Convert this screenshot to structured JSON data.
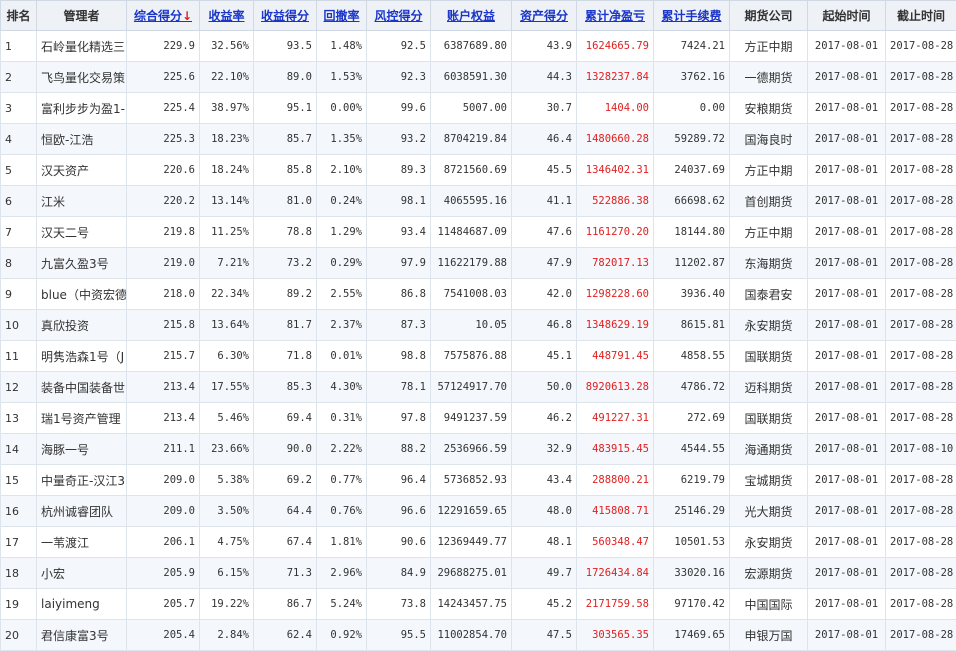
{
  "headers": {
    "rank": "排名",
    "manager": "管理者",
    "composite": "综合得分",
    "composite_arrow": "↓",
    "return_rate": "收益率",
    "return_score": "收益得分",
    "drawdown": "回撤率",
    "risk_score": "风控得分",
    "equity": "账户权益",
    "asset_score": "资产得分",
    "net_pnl": "累计净盈亏",
    "fees": "累计手续费",
    "broker": "期货公司",
    "start": "起始时间",
    "end": "截止时间"
  },
  "colors": {
    "sort_link": "#1a35c8",
    "pnl_red": "#e02020",
    "header_bg": "#eef2f7"
  },
  "rows": [
    {
      "rank": "1",
      "manager": "石岭量化精选三",
      "composite": "229.9",
      "return_rate": "32.56%",
      "return_score": "93.5",
      "drawdown": "1.48%",
      "risk_score": "92.5",
      "equity": "6387689.80",
      "asset_score": "43.9",
      "net_pnl": "1624665.79",
      "fees": "7424.21",
      "broker": "方正中期",
      "start": "2017-08-01",
      "end": "2017-08-28"
    },
    {
      "rank": "2",
      "manager": "飞鸟量化交易策",
      "composite": "225.6",
      "return_rate": "22.10%",
      "return_score": "89.0",
      "drawdown": "1.53%",
      "risk_score": "92.3",
      "equity": "6038591.30",
      "asset_score": "44.3",
      "net_pnl": "1328237.84",
      "fees": "3762.16",
      "broker": "一德期货",
      "start": "2017-08-01",
      "end": "2017-08-28"
    },
    {
      "rank": "3",
      "manager": "富利步步为盈1-",
      "composite": "225.4",
      "return_rate": "38.97%",
      "return_score": "95.1",
      "drawdown": "0.00%",
      "risk_score": "99.6",
      "equity": "5007.00",
      "asset_score": "30.7",
      "net_pnl": "1404.00",
      "fees": "0.00",
      "broker": "安粮期货",
      "start": "2017-08-01",
      "end": "2017-08-28"
    },
    {
      "rank": "4",
      "manager": "恒欧-江浩",
      "composite": "225.3",
      "return_rate": "18.23%",
      "return_score": "85.7",
      "drawdown": "1.35%",
      "risk_score": "93.2",
      "equity": "8704219.84",
      "asset_score": "46.4",
      "net_pnl": "1480660.28",
      "fees": "59289.72",
      "broker": "国海良时",
      "start": "2017-08-01",
      "end": "2017-08-28"
    },
    {
      "rank": "5",
      "manager": "汉天资产",
      "composite": "220.6",
      "return_rate": "18.24%",
      "return_score": "85.8",
      "drawdown": "2.10%",
      "risk_score": "89.3",
      "equity": "8721560.69",
      "asset_score": "45.5",
      "net_pnl": "1346402.31",
      "fees": "24037.69",
      "broker": "方正中期",
      "start": "2017-08-01",
      "end": "2017-08-28"
    },
    {
      "rank": "6",
      "manager": "江米",
      "composite": "220.2",
      "return_rate": "13.14%",
      "return_score": "81.0",
      "drawdown": "0.24%",
      "risk_score": "98.1",
      "equity": "4065595.16",
      "asset_score": "41.1",
      "net_pnl": "522886.38",
      "fees": "66698.62",
      "broker": "首创期货",
      "start": "2017-08-01",
      "end": "2017-08-28"
    },
    {
      "rank": "7",
      "manager": "汉天二号",
      "composite": "219.8",
      "return_rate": "11.25%",
      "return_score": "78.8",
      "drawdown": "1.29%",
      "risk_score": "93.4",
      "equity": "11484687.09",
      "asset_score": "47.6",
      "net_pnl": "1161270.20",
      "fees": "18144.80",
      "broker": "方正中期",
      "start": "2017-08-01",
      "end": "2017-08-28"
    },
    {
      "rank": "8",
      "manager": "九富久盈3号",
      "composite": "219.0",
      "return_rate": "7.21%",
      "return_score": "73.2",
      "drawdown": "0.29%",
      "risk_score": "97.9",
      "equity": "11622179.88",
      "asset_score": "47.9",
      "net_pnl": "782017.13",
      "fees": "11202.87",
      "broker": "东海期货",
      "start": "2017-08-01",
      "end": "2017-08-28"
    },
    {
      "rank": "9",
      "manager": "blue（中资宏德",
      "composite": "218.0",
      "return_rate": "22.34%",
      "return_score": "89.2",
      "drawdown": "2.55%",
      "risk_score": "86.8",
      "equity": "7541008.03",
      "asset_score": "42.0",
      "net_pnl": "1298228.60",
      "fees": "3936.40",
      "broker": "国泰君安",
      "start": "2017-08-01",
      "end": "2017-08-28"
    },
    {
      "rank": "10",
      "manager": "真欣投资",
      "composite": "215.8",
      "return_rate": "13.64%",
      "return_score": "81.7",
      "drawdown": "2.37%",
      "risk_score": "87.3",
      "equity": "10.05",
      "asset_score": "46.8",
      "net_pnl": "1348629.19",
      "fees": "8615.81",
      "broker": "永安期货",
      "start": "2017-08-01",
      "end": "2017-08-28"
    },
    {
      "rank": "11",
      "manager": "明隽浩森1号（J",
      "composite": "215.7",
      "return_rate": "6.30%",
      "return_score": "71.8",
      "drawdown": "0.01%",
      "risk_score": "98.8",
      "equity": "7575876.88",
      "asset_score": "45.1",
      "net_pnl": "448791.45",
      "fees": "4858.55",
      "broker": "国联期货",
      "start": "2017-08-01",
      "end": "2017-08-28"
    },
    {
      "rank": "12",
      "manager": "装备中国装备世",
      "composite": "213.4",
      "return_rate": "17.55%",
      "return_score": "85.3",
      "drawdown": "4.30%",
      "risk_score": "78.1",
      "equity": "57124917.70",
      "asset_score": "50.0",
      "net_pnl": "8920613.28",
      "fees": "4786.72",
      "broker": "迈科期货",
      "start": "2017-08-01",
      "end": "2017-08-28"
    },
    {
      "rank": "13",
      "manager": "瑞1号资产管理",
      "composite": "213.4",
      "return_rate": "5.46%",
      "return_score": "69.4",
      "drawdown": "0.31%",
      "risk_score": "97.8",
      "equity": "9491237.59",
      "asset_score": "46.2",
      "net_pnl": "491227.31",
      "fees": "272.69",
      "broker": "国联期货",
      "start": "2017-08-01",
      "end": "2017-08-28"
    },
    {
      "rank": "14",
      "manager": "海豚一号",
      "composite": "211.1",
      "return_rate": "23.66%",
      "return_score": "90.0",
      "drawdown": "2.22%",
      "risk_score": "88.2",
      "equity": "2536966.59",
      "asset_score": "32.9",
      "net_pnl": "483915.45",
      "fees": "4544.55",
      "broker": "海通期货",
      "start": "2017-08-01",
      "end": "2017-08-10"
    },
    {
      "rank": "15",
      "manager": "中量奇正-汉江3",
      "composite": "209.0",
      "return_rate": "5.38%",
      "return_score": "69.2",
      "drawdown": "0.77%",
      "risk_score": "96.4",
      "equity": "5736852.93",
      "asset_score": "43.4",
      "net_pnl": "288800.21",
      "fees": "6219.79",
      "broker": "宝城期货",
      "start": "2017-08-01",
      "end": "2017-08-28"
    },
    {
      "rank": "16",
      "manager": "杭州诚睿团队",
      "composite": "209.0",
      "return_rate": "3.50%",
      "return_score": "64.4",
      "drawdown": "0.76%",
      "risk_score": "96.6",
      "equity": "12291659.65",
      "asset_score": "48.0",
      "net_pnl": "415808.71",
      "fees": "25146.29",
      "broker": "光大期货",
      "start": "2017-08-01",
      "end": "2017-08-28"
    },
    {
      "rank": "17",
      "manager": "一苇渡江",
      "composite": "206.1",
      "return_rate": "4.75%",
      "return_score": "67.4",
      "drawdown": "1.81%",
      "risk_score": "90.6",
      "equity": "12369449.77",
      "asset_score": "48.1",
      "net_pnl": "560348.47",
      "fees": "10501.53",
      "broker": "永安期货",
      "start": "2017-08-01",
      "end": "2017-08-28"
    },
    {
      "rank": "18",
      "manager": "小宏",
      "composite": "205.9",
      "return_rate": "6.15%",
      "return_score": "71.3",
      "drawdown": "2.96%",
      "risk_score": "84.9",
      "equity": "29688275.01",
      "asset_score": "49.7",
      "net_pnl": "1726434.84",
      "fees": "33020.16",
      "broker": "宏源期货",
      "start": "2017-08-01",
      "end": "2017-08-28"
    },
    {
      "rank": "19",
      "manager": "laiyimeng",
      "composite": "205.7",
      "return_rate": "19.22%",
      "return_score": "86.7",
      "drawdown": "5.24%",
      "risk_score": "73.8",
      "equity": "14243457.75",
      "asset_score": "45.2",
      "net_pnl": "2171759.58",
      "fees": "97170.42",
      "broker": "中国国际",
      "start": "2017-08-01",
      "end": "2017-08-28"
    },
    {
      "rank": "20",
      "manager": "君信康富3号",
      "composite": "205.4",
      "return_rate": "2.84%",
      "return_score": "62.4",
      "drawdown": "0.92%",
      "risk_score": "95.5",
      "equity": "11002854.70",
      "asset_score": "47.5",
      "net_pnl": "303565.35",
      "fees": "17469.65",
      "broker": "申银万国",
      "start": "2017-08-01",
      "end": "2017-08-28"
    }
  ]
}
